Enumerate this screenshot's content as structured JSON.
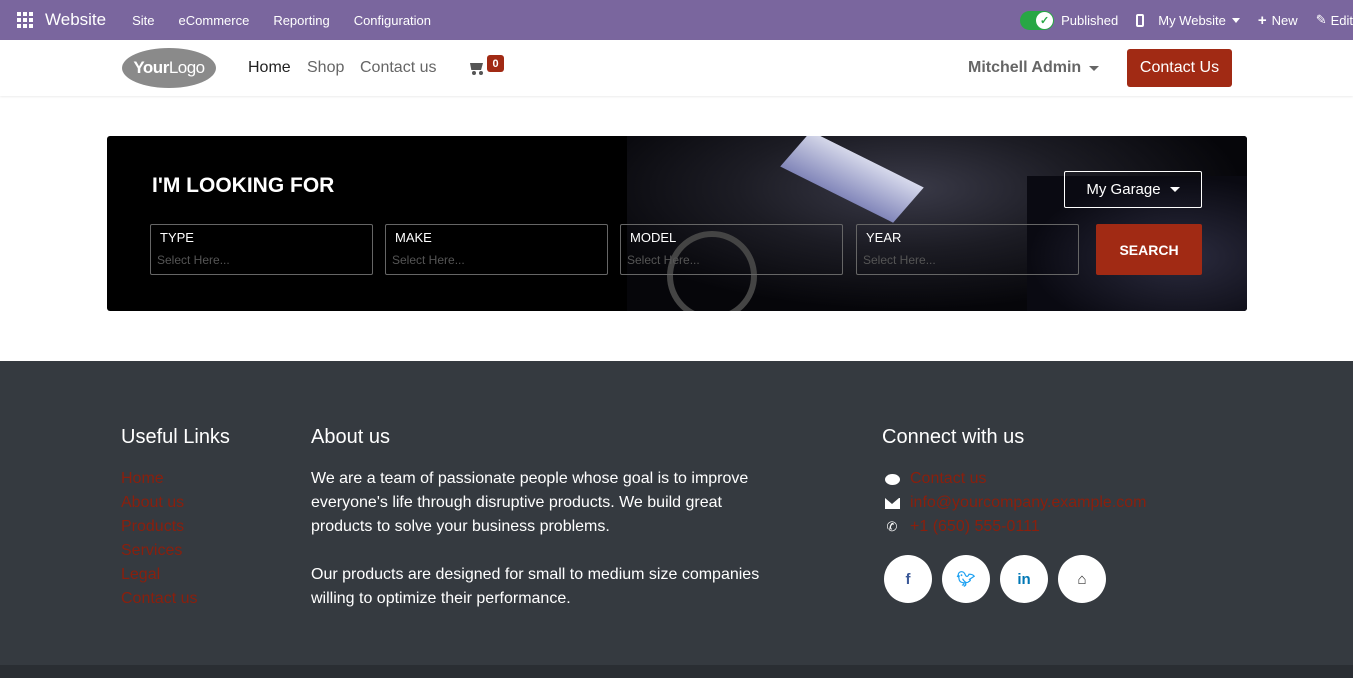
{
  "adminbar": {
    "app_name": "Website",
    "menus": [
      "Site",
      "eCommerce",
      "Reporting",
      "Configuration"
    ],
    "published_label": "Published",
    "website_label": "My Website",
    "new_label": "New",
    "edit_label": "Edit"
  },
  "header": {
    "logo_bold": "Your",
    "logo_light": "Logo",
    "nav": [
      "Home",
      "Shop",
      "Contact us"
    ],
    "cart_count": "0",
    "user_name": "Mitchell Admin",
    "contact_button": "Contact Us"
  },
  "search": {
    "title": "I'M LOOKING FOR",
    "garage_button": "My Garage",
    "fields": [
      {
        "label": "TYPE",
        "placeholder": "Select Here..."
      },
      {
        "label": "MAKE",
        "placeholder": "Select Here..."
      },
      {
        "label": "MODEL",
        "placeholder": "Select Here..."
      },
      {
        "label": "YEAR",
        "placeholder": "Select Here..."
      }
    ],
    "button": "SEARCH"
  },
  "footer": {
    "useful_links_title": "Useful Links",
    "useful_links": [
      "Home",
      "About us",
      "Products",
      "Services",
      "Legal",
      "Contact us"
    ],
    "about_title": "About us",
    "about_p1": "We are a team of passionate people whose goal is to improve everyone's life through disruptive products. We build great products to solve your business problems.",
    "about_p2": "Our products are designed for small to medium size companies willing to optimize their performance.",
    "connect_title": "Connect with us",
    "contact_link": "Contact us",
    "email": "info@yourcompany.example.com",
    "phone": "+1 (650) 555-0111",
    "socials": [
      "facebook-icon",
      "twitter-icon",
      "linkedin-icon",
      "home-icon"
    ]
  },
  "colors": {
    "admin_bar": "#7a669e",
    "accent": "#a12a14",
    "footer_bg": "#353a40",
    "published_toggle": "#28a745"
  }
}
